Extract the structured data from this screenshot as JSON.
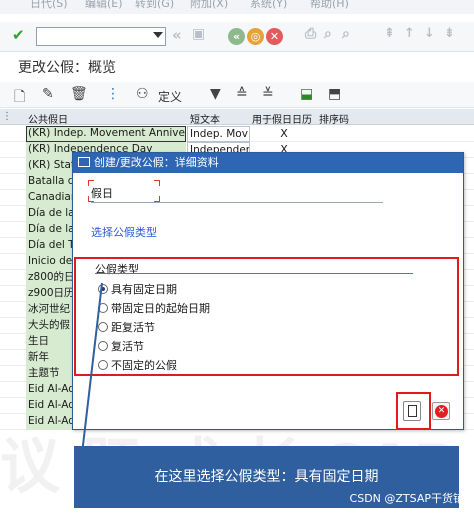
{
  "menu": [
    "日代(S)",
    "编辑(E)",
    "转到(G)",
    "附加(X)",
    "系统(Y)",
    "帮助(H)"
  ],
  "screen_title": "更改公假：概览",
  "app_toolbar": {
    "define_label": "定义"
  },
  "table": {
    "headers": [
      "公共假日",
      "短文本",
      "用于假日日历",
      "排序码"
    ],
    "rows": [
      {
        "name": "(KR) Indep. Movement Annivers.",
        "short": "Indep. Mov",
        "used": "X"
      },
      {
        "name": "(KR) Independence Day",
        "short": "Independen",
        "used": "X"
      },
      {
        "name": "(KR) Stat",
        "short": "",
        "used": ""
      },
      {
        "name": "Batalla de",
        "short": "",
        "used": ""
      },
      {
        "name": "Canadian",
        "short": "",
        "used": ""
      },
      {
        "name": "Día de la",
        "short": "",
        "used": ""
      },
      {
        "name": "Día de la",
        "short": "",
        "used": ""
      },
      {
        "name": "Día del T",
        "short": "",
        "used": ""
      },
      {
        "name": "Inicio de",
        "short": "",
        "used": ""
      },
      {
        "name": "z800的日",
        "short": "",
        "used": ""
      },
      {
        "name": "z900日历",
        "short": "",
        "used": ""
      },
      {
        "name": "冰河世纪",
        "short": "",
        "used": ""
      },
      {
        "name": "大头的假",
        "short": "",
        "used": ""
      },
      {
        "name": "生日",
        "short": "",
        "used": ""
      },
      {
        "name": "新年",
        "short": "",
        "used": ""
      },
      {
        "name": "主题节",
        "short": "",
        "used": ""
      },
      {
        "name": "Eid Al-Ad",
        "short": "",
        "used": ""
      },
      {
        "name": "Eid Al-Ad",
        "short": "",
        "used": ""
      },
      {
        "name": "Eid Al-Ad",
        "short": "",
        "used": ""
      }
    ]
  },
  "dialog": {
    "title": "创建/更改公假：详细资料",
    "field_label": "假日",
    "link_label": "选择公假类型",
    "group_title": "公假类型",
    "options": [
      {
        "label": "具有固定日期",
        "selected": true
      },
      {
        "label": "带固定日的起始日期",
        "selected": false
      },
      {
        "label": "距复活节",
        "selected": false
      },
      {
        "label": "复活节",
        "selected": false
      },
      {
        "label": "不固定的公假",
        "selected": false
      }
    ]
  },
  "callout": "在这里选择公假类型：具有固定日期",
  "watermark": "CSDN @ZTSAP干货铺",
  "colors": {
    "dialog_title_bg": "#2f66b3",
    "highlight_red": "#e11b1b",
    "callout_bg": "#2f5f9e",
    "row_green": "#d7ebd0"
  }
}
